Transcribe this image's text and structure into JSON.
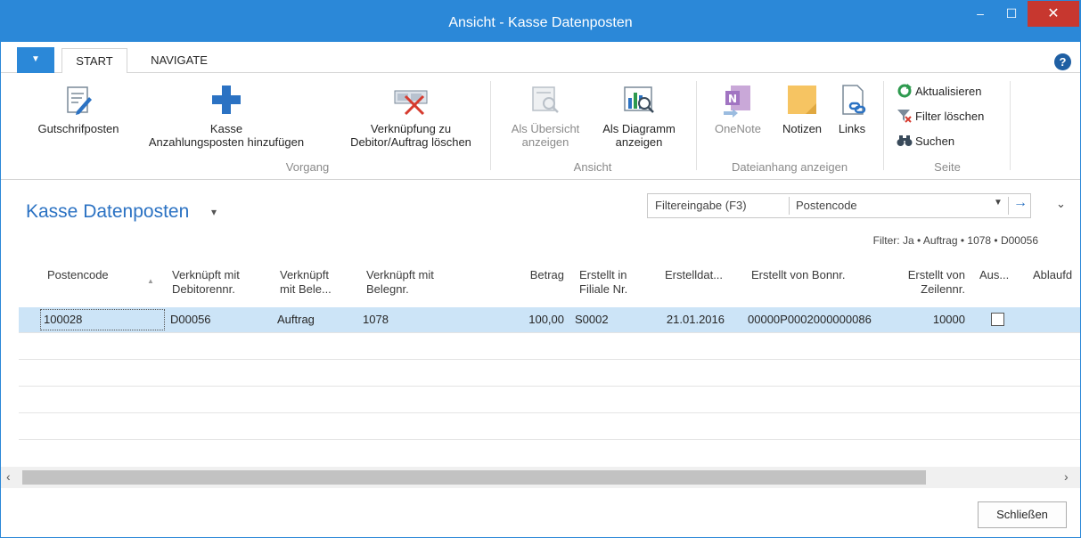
{
  "window": {
    "title": "Ansicht - Kasse Datenposten",
    "minimize": "–",
    "maximize": "☐",
    "close": "✕"
  },
  "tabs": {
    "menu_glyph": "▼",
    "start": "START",
    "navigate": "NAVIGATE",
    "help": "?"
  },
  "ribbon": {
    "gutschrifposten": "Gutschrifposten",
    "kasse_line1": "Kasse",
    "kasse_line2": "Anzahlungsposten hinzufügen",
    "verknuepfung_line1": "Verknüpfung zu",
    "verknuepfung_line2": "Debitor/Auftrag löschen",
    "group_vorgang": "Vorgang",
    "uebersicht_line1": "Als Übersicht",
    "uebersicht_line2": "anzeigen",
    "diagramm_line1": "Als Diagramm",
    "diagramm_line2": "anzeigen",
    "group_ansicht": "Ansicht",
    "onenote": "OneNote",
    "notizen": "Notizen",
    "links": "Links",
    "group_dateianhang": "Dateianhang anzeigen",
    "aktualisieren": "Aktualisieren",
    "filter_loeschen": "Filter löschen",
    "suchen": "Suchen",
    "group_seite": "Seite"
  },
  "page": {
    "title": "Kasse Datenposten",
    "title_caret": "▾",
    "filter_placeholder": "Filtereingabe (F3)",
    "filter_field": "Postencode",
    "filter_drop": "▼",
    "filter_go": "→",
    "collapse": "⌄",
    "filter_summary": "Filter: Ja • Auftrag • 1078 • D00056"
  },
  "table": {
    "headers": {
      "postencode": "Postencode",
      "debitor_l1": "Verknüpft mit",
      "debitor_l2": "Debitorennr.",
      "beleg_l1": "Verknüpft",
      "beleg_l2": "mit Bele...",
      "belegnr_l1": "Verknüpft mit",
      "belegnr_l2": "Belegnr.",
      "betrag": "Betrag",
      "filiale_l1": "Erstellt in",
      "filiale_l2": "Filiale Nr.",
      "erstelldat": "Erstelldat...",
      "bonnr": "Erstellt von Bonnr.",
      "zeilennr_l1": "Erstellt von",
      "zeilennr_l2": "Zeilennr.",
      "aus": "Aus...",
      "ablauf": "Ablaufd"
    },
    "rows": [
      {
        "postencode": "100028",
        "debitor": "D00056",
        "beleg": "Auftrag",
        "belegnr": "1078",
        "betrag": "100,00",
        "filiale": "S0002",
        "erstelldat": "21.01.2016",
        "bonnr": "00000P0002000000086",
        "zeilennr": "10000",
        "aus": false
      }
    ]
  },
  "scrollbar": {
    "left": "‹",
    "right": "›"
  },
  "footer": {
    "close_label": "Schließen"
  }
}
